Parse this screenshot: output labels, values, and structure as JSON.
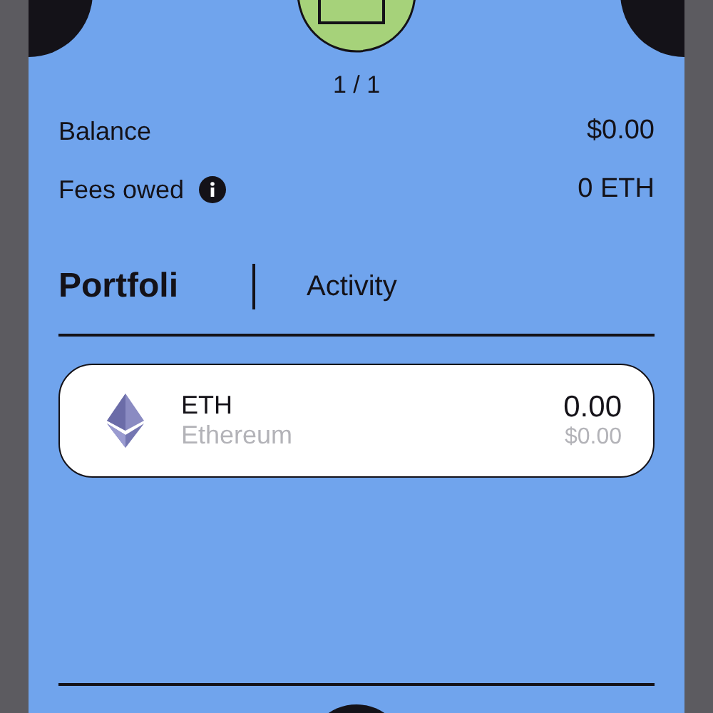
{
  "pager": "1 / 1",
  "summary": [
    {
      "label": "Balance",
      "value": "$0.00",
      "info": false
    },
    {
      "label": "Fees owed",
      "value": "0 ETH",
      "info": true
    }
  ],
  "tabs": [
    {
      "label": "Portfoli",
      "selected": true
    },
    {
      "label": "Activity",
      "selected": false
    }
  ],
  "assets": [
    {
      "symbol": "ETH",
      "name": "Ethereum",
      "amount": "0.00",
      "fiat": "$0.00"
    }
  ]
}
